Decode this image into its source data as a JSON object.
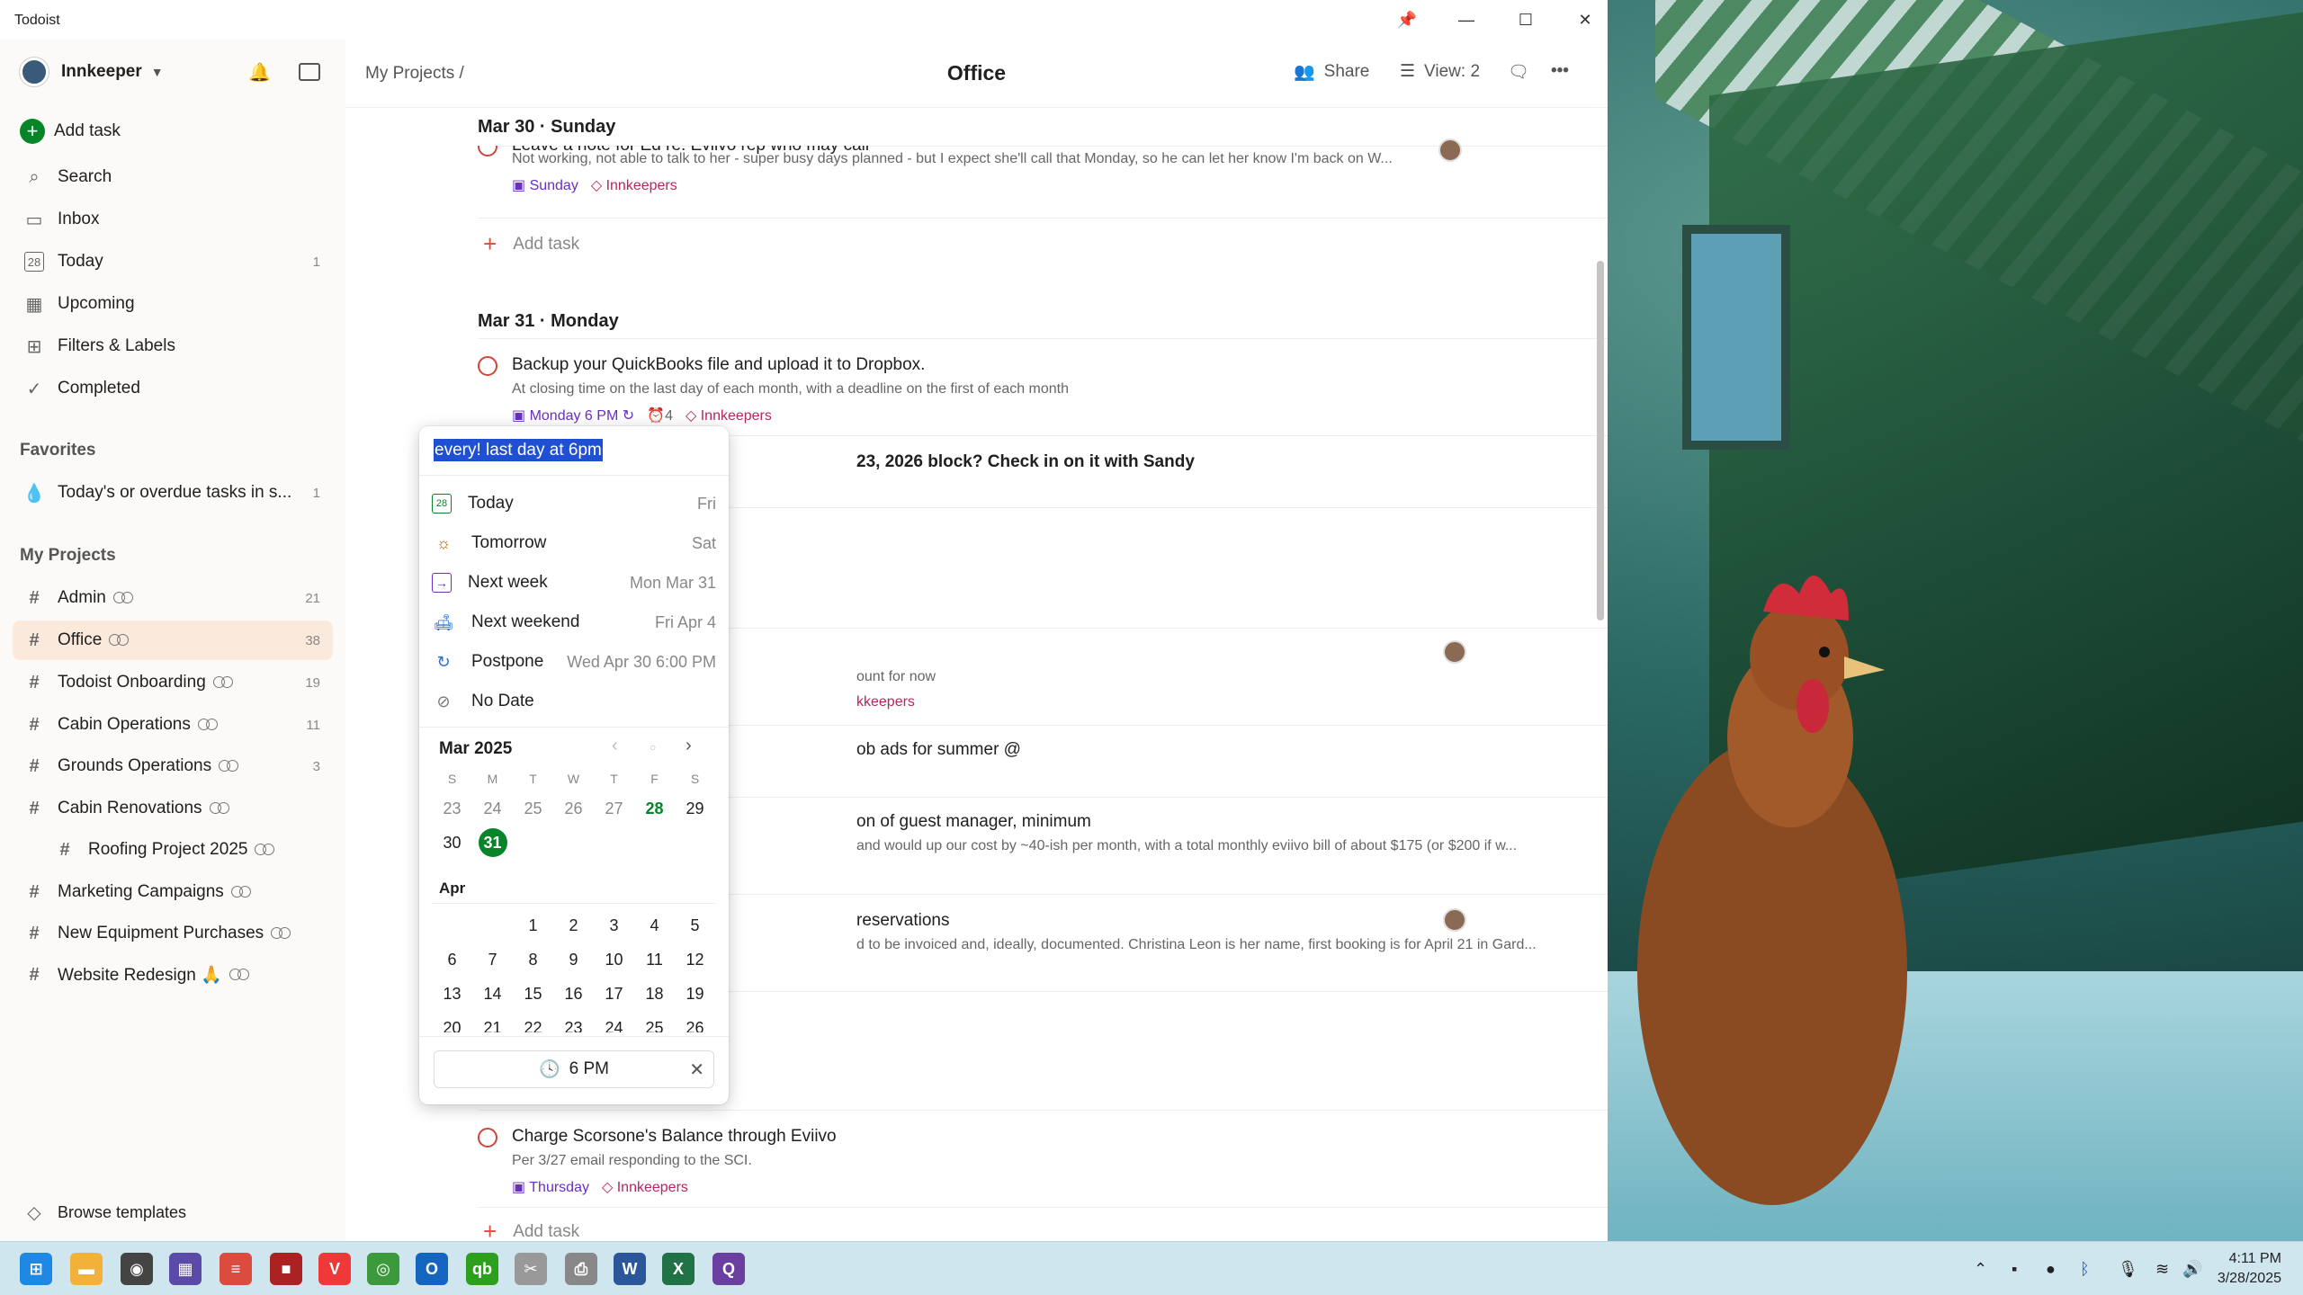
{
  "window": {
    "title": "Todoist"
  },
  "sidebar": {
    "user": "Innkeeper",
    "add_task": "Add task",
    "nav": [
      {
        "label": "Search",
        "icon": "search-icon",
        "count": ""
      },
      {
        "label": "Inbox",
        "icon": "inbox-icon",
        "count": ""
      },
      {
        "label": "Today",
        "icon": "calendar-today-icon",
        "count": "1"
      },
      {
        "label": "Upcoming",
        "icon": "calendar-upcoming-icon",
        "count": ""
      },
      {
        "label": "Filters & Labels",
        "icon": "grid-icon",
        "count": ""
      },
      {
        "label": "Completed",
        "icon": "check-circle-icon",
        "count": ""
      }
    ],
    "favorites_title": "Favorites",
    "favorites": [
      {
        "label": "Today's or overdue tasks in s...",
        "count": "1"
      }
    ],
    "projects_title": "My Projects",
    "projects": [
      {
        "label": "Admin",
        "count": "21",
        "shared": true
      },
      {
        "label": "Office",
        "count": "38",
        "shared": true,
        "active": true
      },
      {
        "label": "Todoist Onboarding",
        "count": "19",
        "shared": true
      },
      {
        "label": "Cabin Operations",
        "count": "11",
        "shared": true
      },
      {
        "label": "Grounds Operations",
        "count": "3",
        "shared": true
      },
      {
        "label": "Cabin Renovations",
        "count": "",
        "shared": true
      },
      {
        "label": "Roofing Project 2025",
        "count": "",
        "shared": true,
        "indent": true
      },
      {
        "label": "Marketing Campaigns",
        "count": "",
        "shared": true
      },
      {
        "label": "New Equipment Purchases",
        "count": "",
        "shared": true
      },
      {
        "label": "Website Redesign 🙏",
        "count": "",
        "shared": true
      }
    ],
    "browse_templates": "Browse templates"
  },
  "header": {
    "breadcrumb": "My Projects /",
    "title": "Office",
    "share": "Share",
    "view": "View: 2"
  },
  "content": {
    "day1": "Mar 30 · Sunday",
    "task1": {
      "title": "Leave a note for Ed re: Eviivo rep who may call",
      "desc": "Not working, not able to talk to her - super busy days planned - but I expect she'll call that Monday, so he can let her know I'm back on W...",
      "date": "Sunday",
      "label": "Innkeepers"
    },
    "add_task": "Add task",
    "day2": "Mar 31 · Monday",
    "task2": {
      "title": "Backup your QuickBooks file and upload it to Dropbox.",
      "desc": "At closing time on the last day of each month, with a deadline on the first of each month",
      "date": "Monday 6 PM",
      "reminders": "4",
      "label": "Innkeepers"
    },
    "task3": {
      "title": "23, 2026 block? Check in on it with Sandy"
    },
    "task4": {
      "desc": "ount for now",
      "label": "kkeepers"
    },
    "task5": {
      "title": "ob ads for summer @"
    },
    "task6": {
      "title": "on of guest manager, minimum",
      "desc": "and would up our cost by ~40-ish per month, with a total monthly eviivo bill of about $175 (or $200 if w..."
    },
    "task7": {
      "title": "reservations",
      "desc": "d to be invoiced and, ideally, documented. Christina Leon is her name, first booking is for April 21 in Gard..."
    },
    "task8": {
      "title": "Charge Scorsone's Balance through Eviivo",
      "desc": "Per 3/27 email responding to the SCI.",
      "date": "Thursday",
      "label": "Innkeepers"
    },
    "add_task_2": "Add task"
  },
  "picker": {
    "input": "every! last day at 6pm",
    "options": [
      {
        "label": "Today",
        "value": "Fri",
        "icon": "calendar-today-icon",
        "color": "#058527"
      },
      {
        "label": "Tomorrow",
        "value": "Sat",
        "icon": "sun-icon",
        "color": "#ad6200"
      },
      {
        "label": "Next week",
        "value": "Mon Mar 31",
        "icon": "arrow-right-box-icon",
        "color": "#692fc2"
      },
      {
        "label": "Next weekend",
        "value": "Fri Apr 4",
        "icon": "couch-icon",
        "color": "#246fe0"
      },
      {
        "label": "Postpone",
        "value": "Wed Apr 30 6:00 PM",
        "icon": "postpone-icon",
        "color": "#246fe0"
      },
      {
        "label": "No Date",
        "value": "",
        "icon": "no-date-icon",
        "color": "#777"
      }
    ],
    "month1": "Mar 2025",
    "weekdays": [
      "S",
      "M",
      "T",
      "W",
      "T",
      "F",
      "S"
    ],
    "mar_rows": [
      [
        "23",
        "24",
        "25",
        "26",
        "27",
        "28",
        "29"
      ],
      [
        "30",
        "31",
        "",
        "",
        "",
        "",
        ""
      ]
    ],
    "month2": "Apr",
    "apr_rows": [
      [
        "",
        "1",
        "2",
        "3",
        "4",
        "5"
      ],
      [
        "6",
        "7",
        "8",
        "9",
        "10",
        "11",
        "12"
      ],
      [
        "13",
        "14",
        "15",
        "16",
        "17",
        "18",
        "19"
      ],
      [
        "20",
        "21",
        "22",
        "23",
        "24",
        "25",
        "26"
      ]
    ],
    "time": "6 PM"
  },
  "taskbar": {
    "clock_time": "4:11 PM",
    "clock_date": "3/28/2025"
  }
}
